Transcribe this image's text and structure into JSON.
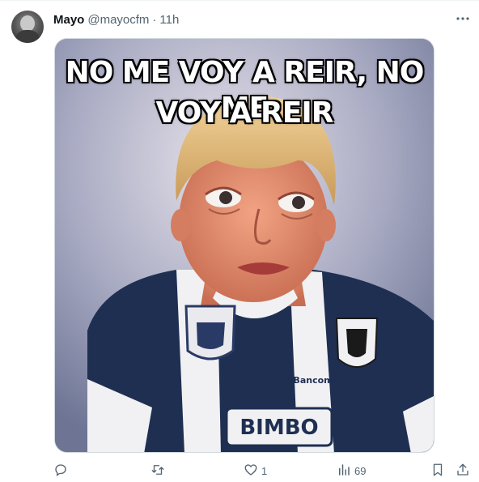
{
  "tweet": {
    "author_name": "Mayo",
    "author_handle": "@mayocfm",
    "separator": "·",
    "time": "11h"
  },
  "media": {
    "caption_line1": "NO ME VOY A REIR, NO ME",
    "caption_line2": "VOY A REIR",
    "jersey_sponsor": "BIMBO",
    "jersey_bank": "BBVA Bancomer"
  },
  "actions": {
    "reply_count": "",
    "retweet_count": "",
    "like_count": "1",
    "views_count": "69"
  },
  "icons": [
    "more-icon",
    "reply-icon",
    "retweet-icon",
    "like-icon",
    "views-icon",
    "bookmark-icon",
    "share-icon"
  ]
}
